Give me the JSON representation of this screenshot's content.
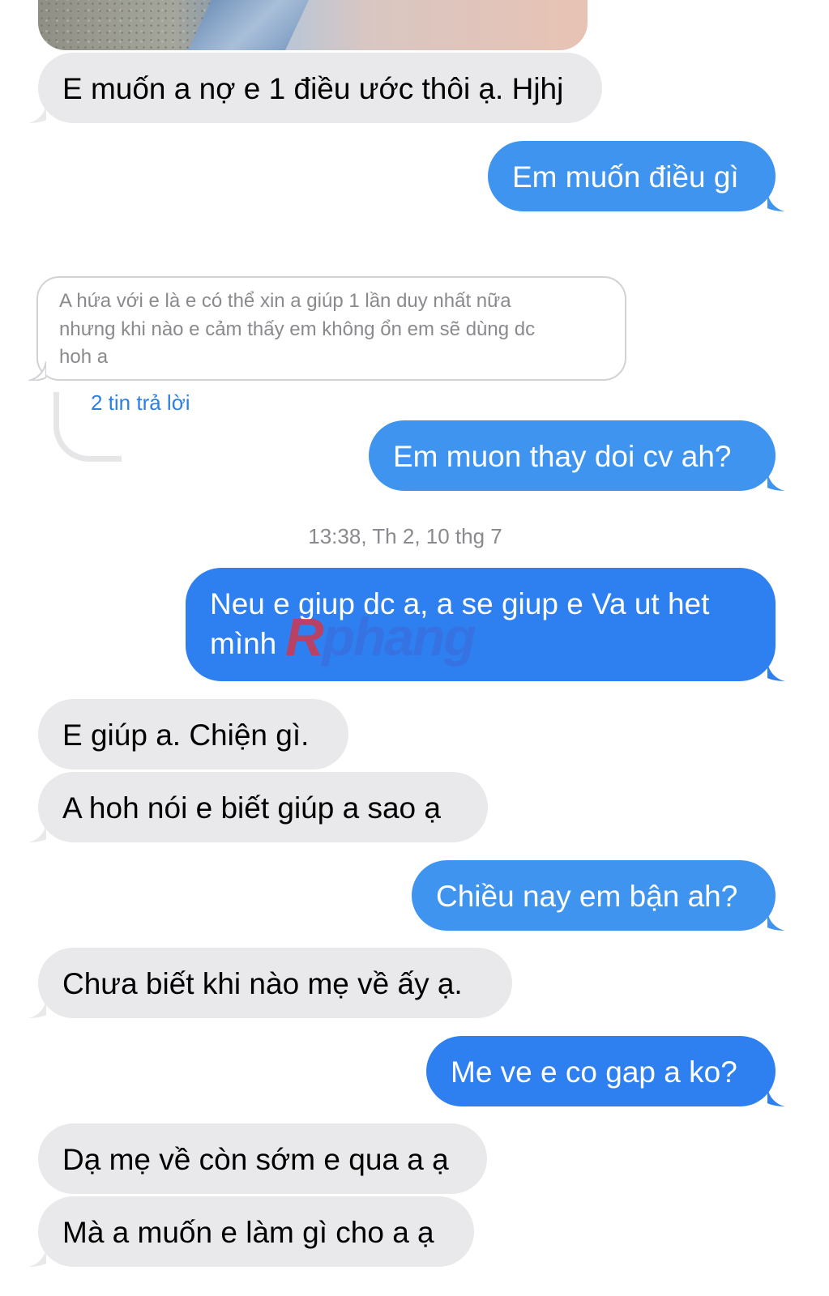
{
  "messages": {
    "m1": "E muốn a nợ e 1 điều ước thôi ạ. Hjhj",
    "m2": "Em muốn điều gì",
    "quoted_reply": {
      "line1": "A hứa với e là e có thể xin a giúp 1 lần duy nhất nữa",
      "line2": "nhưng khi nào e cảm thấy em không ổn em sẽ dùng dc",
      "line3": "hoh a",
      "reply_count": "2 tin trả lời"
    },
    "m3": "Em muon thay doi cv ah?",
    "timestamp": "13:38, Th 2, 10 thg 7",
    "m4_line1": "Neu e giup dc a, a se giup e Va ut het",
    "m4_line2": "mình",
    "m5": "E giúp a. Chiện gì.",
    "m6": "A hoh nói e biết giúp a sao ạ",
    "m7": "Chiều nay em bận ah?",
    "m8": "Chưa biết khi nào mẹ về ấy ạ.",
    "m9": "Me ve e co gap a ko?",
    "m10": "Dạ mẹ về còn sớm e qua a ạ",
    "m11": "Mà a muốn e làm gì cho a ạ"
  },
  "watermark": {
    "first": "R",
    "rest": "phang"
  },
  "colors": {
    "incoming": "#e9e9eb",
    "outgoing": "#3e94ef",
    "link": "#2d7fe0"
  }
}
